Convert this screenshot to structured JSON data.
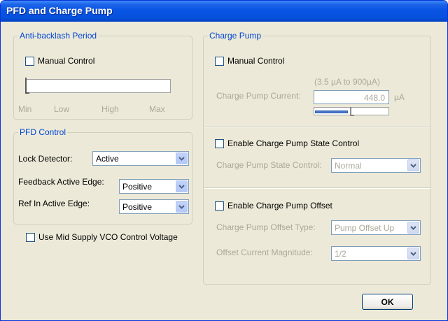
{
  "window": {
    "title": "PFD and Charge Pump"
  },
  "anti_backlash": {
    "legend": "Anti-backlash Period",
    "manual_control_label": "Manual Control",
    "slider_labels": [
      "Min",
      "Low",
      "High",
      "Max"
    ]
  },
  "pfd_control": {
    "legend": "PFD Control",
    "lock_detector_label": "Lock Detector:",
    "lock_detector_value": "Active",
    "feedback_edge_label": "Feedback Active Edge:",
    "feedback_edge_value": "Positive",
    "ref_in_edge_label": "Ref In Active Edge:",
    "ref_in_edge_value": "Positive"
  },
  "mid_supply_label": "Use Mid Supply VCO Control Voltage",
  "charge_pump": {
    "legend": "Charge Pump",
    "manual_control_label": "Manual Control",
    "range_hint": "(3.5 µA to 900µA)",
    "current_label": "Charge Pump Current:",
    "current_value": "448.0",
    "current_unit": "µA",
    "current_fraction": 0.5,
    "state_control_checkbox": "Enable Charge Pump State Control",
    "state_control_label": "Charge Pump State Control:",
    "state_control_value": "Normal",
    "offset_checkbox": "Enable Charge Pump Offset",
    "offset_type_label": "Charge Pump Offset Type:",
    "offset_type_value": "Pump Offset Up",
    "offset_magnitude_label": "Offset Current Magnitude:",
    "offset_magnitude_value": "1/2"
  },
  "buttons": {
    "ok": "OK"
  },
  "colors": {
    "title_bar": "#0a54e4",
    "group_legend": "#0046d5",
    "disabled_text": "#aca899",
    "face": "#ece9d8"
  }
}
